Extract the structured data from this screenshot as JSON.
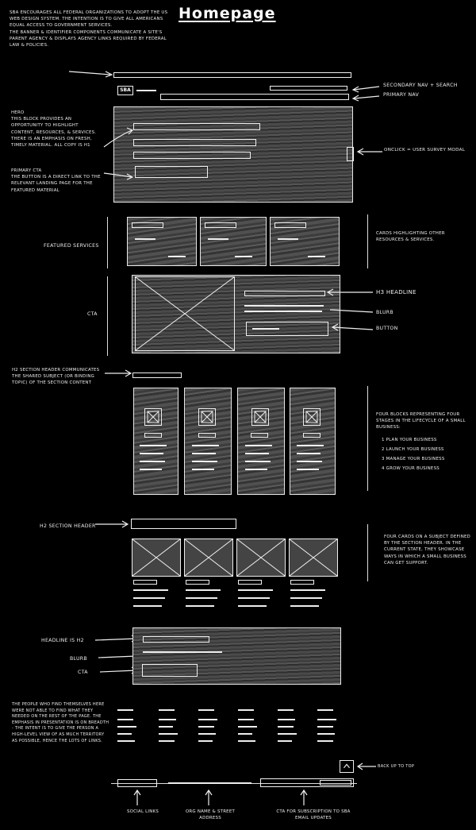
{
  "title": "Homepage",
  "intro": "SBA encourages all federal organizations to adopt the US web design system. The intention is to give all Americans equal access to government services.\nThe banner & identifier components communicate a site's parent agency & displays agency links required by federal law & policies.",
  "header": {
    "logo": "SBA",
    "note_secondary": "Secondary nav + search",
    "note_primary": "Primary nav"
  },
  "hero": {
    "note": "Hero\nThis block provides an opportunity to highlight content, resources, & services. There is an emphasis on fresh, timely material. All copy is H1",
    "cta_note": "Primary CTA\nThe button is a direct link to the relevant landing page for the featured material",
    "onclick_note": "Onclick = user survey modal"
  },
  "featured": {
    "label": "Featured services",
    "note": "Cards highlighting other resources & services."
  },
  "cta": {
    "label": "CTA",
    "h3_note": "H3 headline",
    "blurb_note": "Blurb",
    "button_note": "Button"
  },
  "stages": {
    "h2_note": "H2 section header communicates the shared subject (or binding topic) of the section content",
    "note": "Four blocks representing four stages in the lifecycle of a small business:",
    "items": [
      "1 Plan your business",
      "2 Launch your business",
      "3 Manage your business",
      "4 Grow your business"
    ]
  },
  "support": {
    "h2_note": "H2 section header",
    "note": "Four cards on a subject defined by the section header. In the current state, they showcase ways in which a small business can get support."
  },
  "banner": {
    "headline_note": "Headline is H2",
    "blurb_note": "Blurb",
    "cta_note": "CTA"
  },
  "footer": {
    "note": "The people who find themselves here were not able to find what they needed on the rest of the page. The emphasis in presentation is on breadth - the intent is to give the person a high-level view of as much territory as possible, hence the lots of links.",
    "back_to_top": "Back up to top",
    "social": "Social links",
    "org": "Org name & street address",
    "subscribe": "CTA for subscription to SBA email updates"
  }
}
